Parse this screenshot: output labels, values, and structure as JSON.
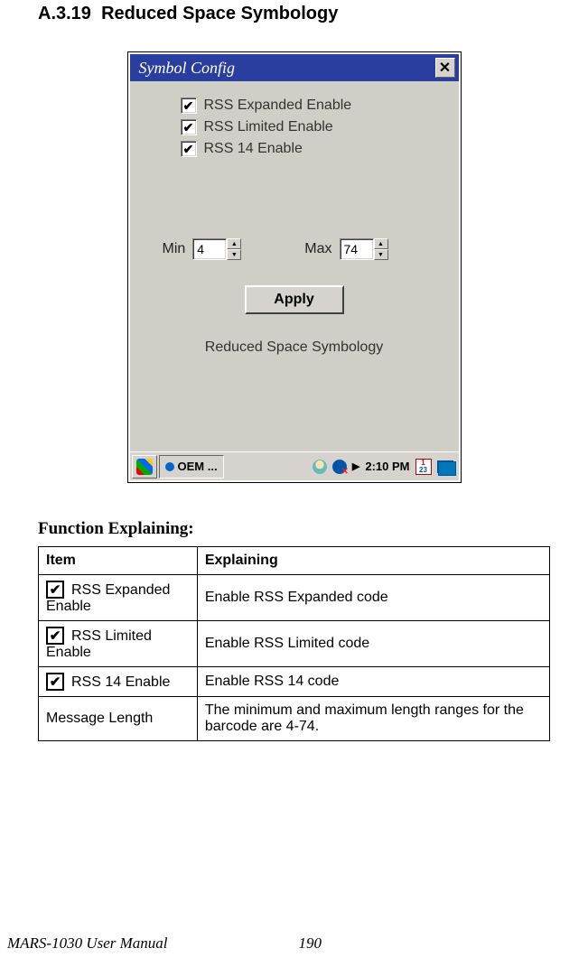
{
  "section_number": "A.3.19",
  "section_title": "Reduced Space Symbology",
  "dialog": {
    "title": "Symbol Config",
    "checkboxes": [
      {
        "label": "RSS Expanded Enable",
        "checked": true
      },
      {
        "label": "RSS Limited Enable",
        "checked": true
      },
      {
        "label": "RSS 14 Enable",
        "checked": true
      }
    ],
    "min_label": "Min",
    "min_value": "4",
    "max_label": "Max",
    "max_value": "74",
    "apply_label": "Apply",
    "caption": "Reduced Space Symbology"
  },
  "taskbar": {
    "task_label": "OEM ...",
    "time": "2:10 PM",
    "cal_top": "1",
    "cal_bot": "23"
  },
  "function_heading": "Function Explaining:",
  "table": {
    "header_item": "Item",
    "header_explaining": "Explaining",
    "rows": [
      {
        "item": "RSS Expanded Enable",
        "has_checkbox": true,
        "explaining": "Enable RSS Expanded code"
      },
      {
        "item": "RSS Limited Enable",
        "has_checkbox": true,
        "explaining": "Enable RSS Limited code"
      },
      {
        "item": "RSS 14 Enable",
        "has_checkbox": true,
        "explaining": "Enable RSS 14 code"
      },
      {
        "item": "Message Length",
        "has_checkbox": false,
        "explaining": "The minimum and maximum length ranges for the barcode are 4-74."
      }
    ]
  },
  "footer": {
    "manual": "MARS-1030 User Manual",
    "page": "190"
  }
}
